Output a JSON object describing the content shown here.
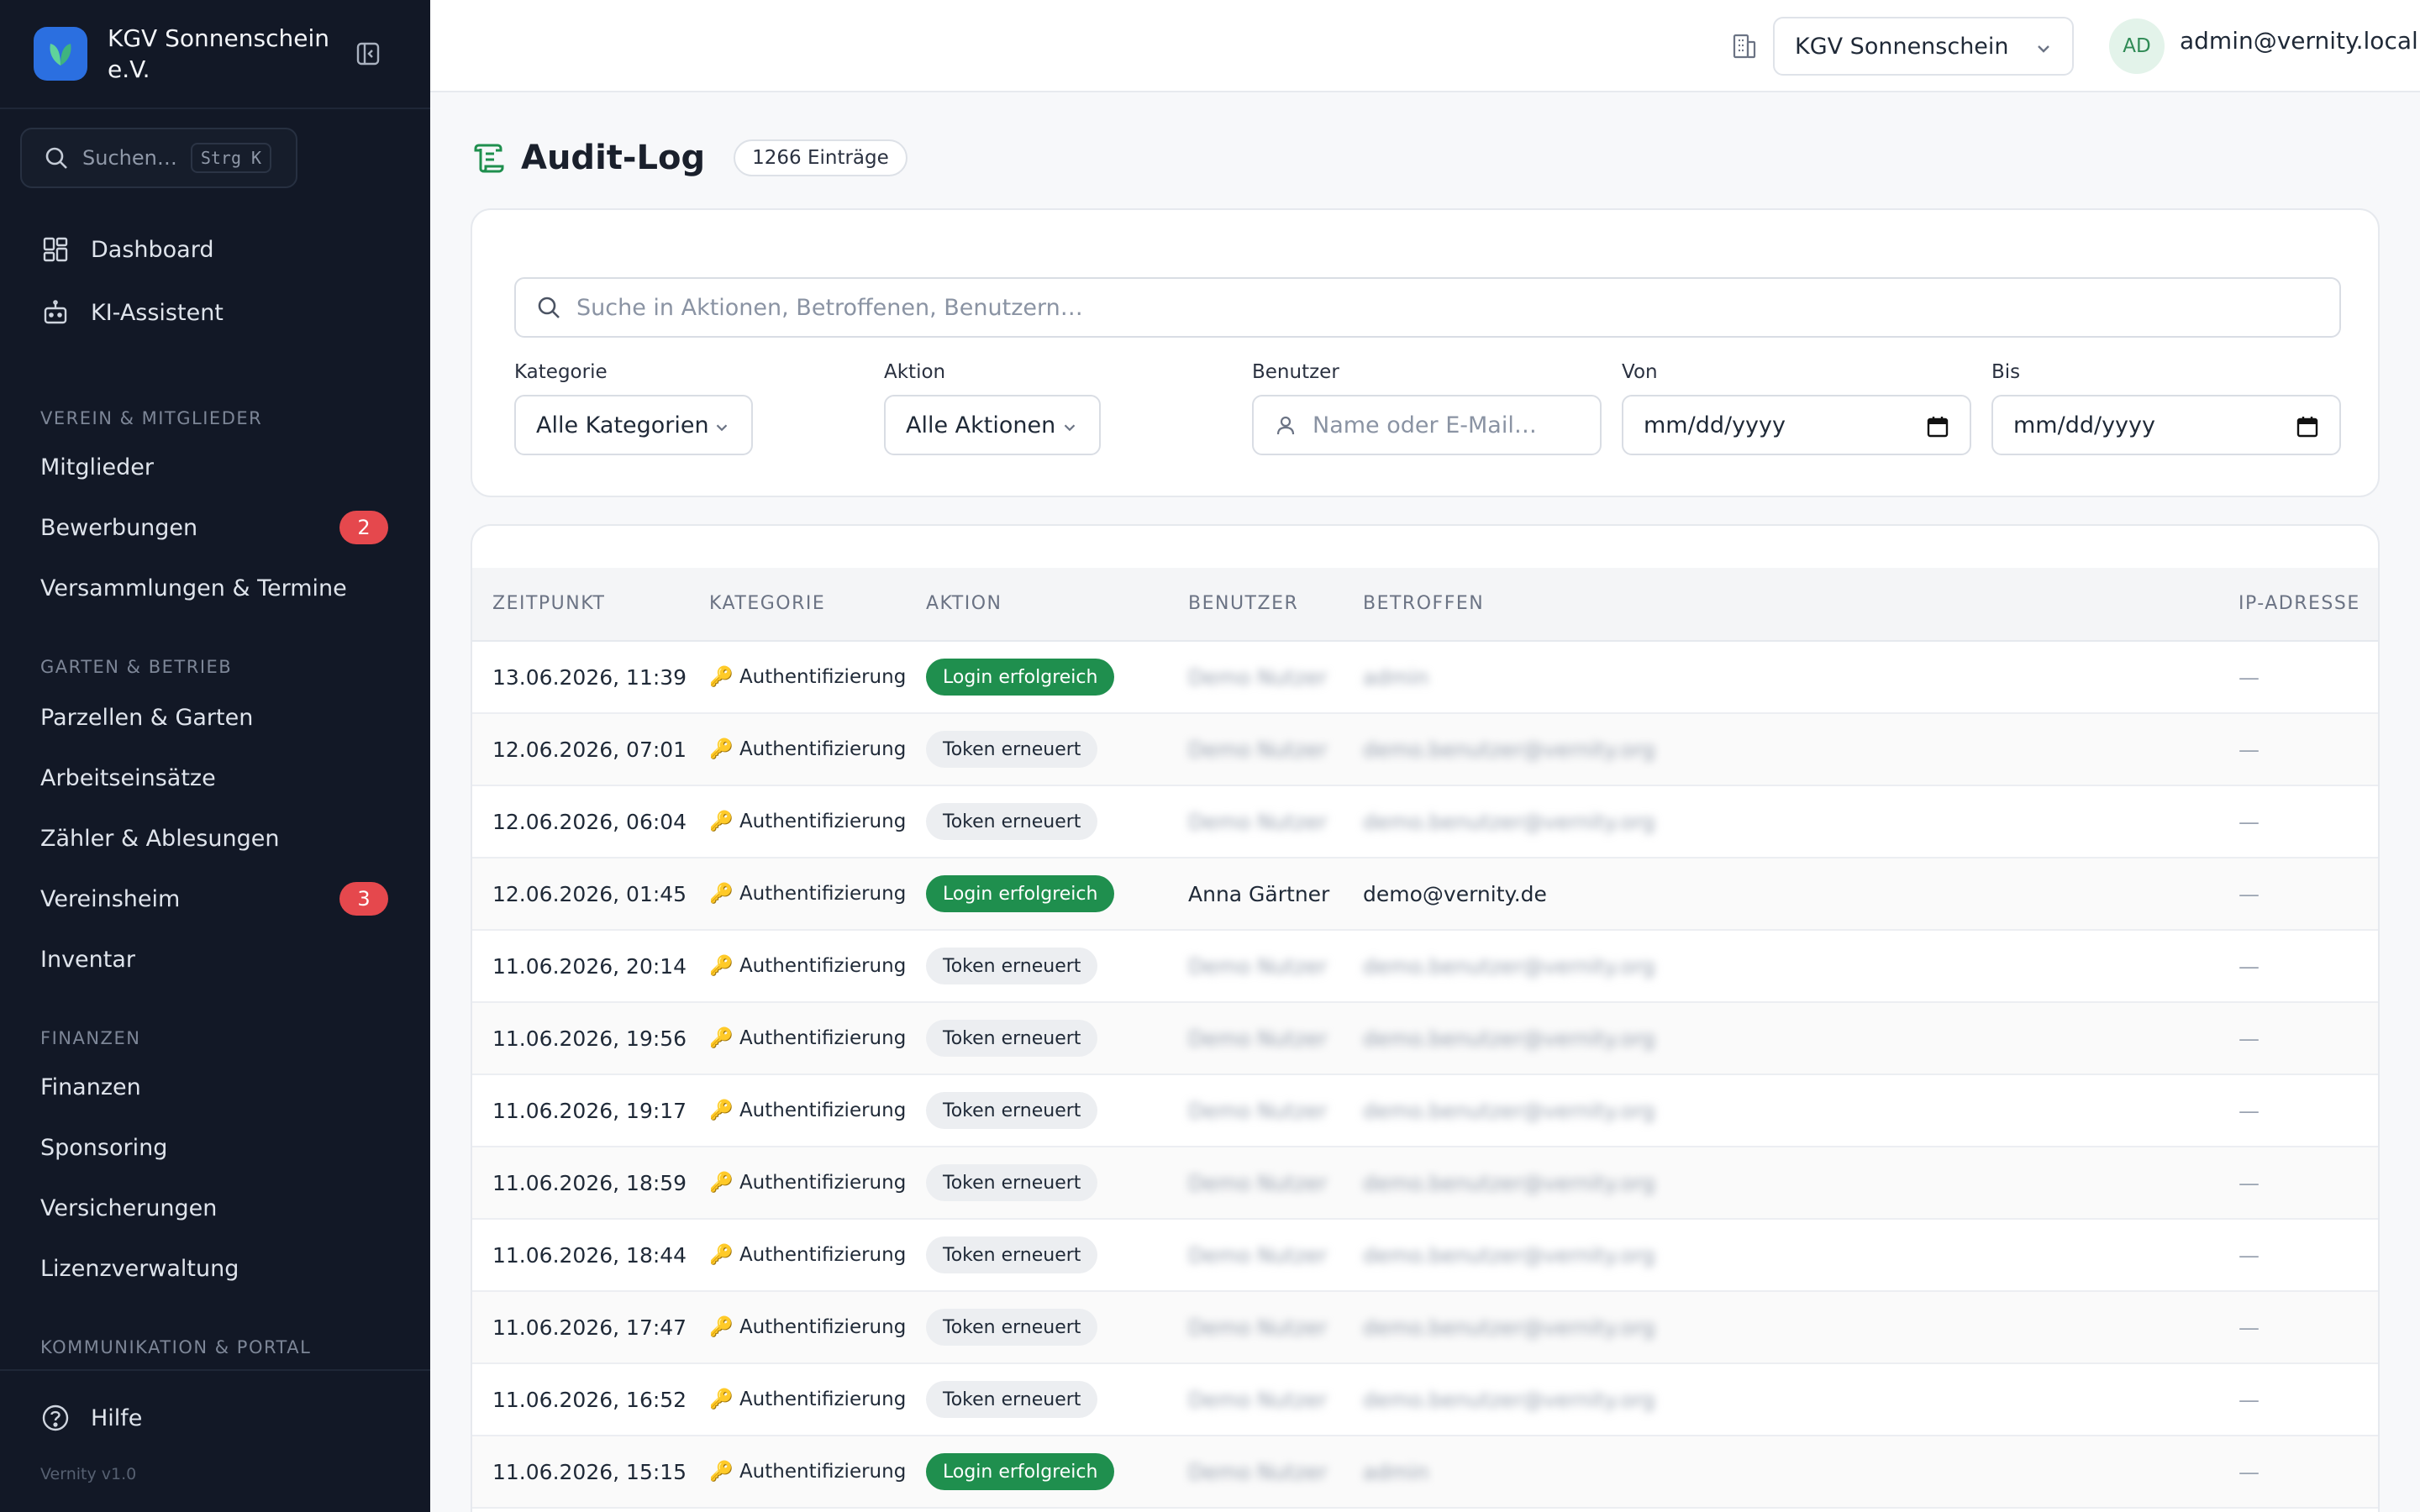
{
  "sidebar": {
    "org_name": "KGV Sonnenschein e.V.",
    "search_placeholder": "Suchen…",
    "search_shortcut": "Strg K",
    "top_items": [
      {
        "label": "Dashboard",
        "icon": "dashboard-icon"
      },
      {
        "label": "KI-Assistent",
        "icon": "robot-icon"
      }
    ],
    "sections": [
      {
        "title": "VEREIN & MITGLIEDER",
        "items": [
          {
            "label": "Mitglieder"
          },
          {
            "label": "Bewerbungen",
            "badge": "2"
          },
          {
            "label": "Versammlungen & Termine"
          }
        ]
      },
      {
        "title": "GARTEN & BETRIEB",
        "items": [
          {
            "label": "Parzellen & Garten"
          },
          {
            "label": "Arbeitseinsätze"
          },
          {
            "label": "Zähler & Ablesungen"
          },
          {
            "label": "Vereinsheim",
            "badge": "3"
          },
          {
            "label": "Inventar"
          }
        ]
      },
      {
        "title": "FINANZEN",
        "items": [
          {
            "label": "Finanzen"
          },
          {
            "label": "Sponsoring"
          },
          {
            "label": "Versicherungen"
          },
          {
            "label": "Lizenzverwaltung"
          }
        ]
      },
      {
        "title": "KOMMUNIKATION & PORTAL",
        "items": []
      }
    ],
    "help_label": "Hilfe",
    "version": "Vernity v1.0"
  },
  "topbar": {
    "org_select_value": "KGV Sonnenschein e.V.",
    "avatar_initials": "AD",
    "user_email": "admin@vernity.local"
  },
  "page": {
    "title": "Audit-Log",
    "entry_count": "1266 Einträge"
  },
  "filters": {
    "search_placeholder": "Suche in Aktionen, Betroffenen, Benutzern…",
    "category_label": "Kategorie",
    "category_value": "Alle Kategorien",
    "action_label": "Aktion",
    "action_value": "Alle Aktionen",
    "user_label": "Benutzer",
    "user_placeholder": "Name oder E-Mail…",
    "from_label": "Von",
    "from_placeholder": "mm/dd/yyyy",
    "to_label": "Bis",
    "to_placeholder": "mm/dd/yyyy"
  },
  "table": {
    "columns": [
      "ZEITPUNKT",
      "KATEGORIE",
      "AKTION",
      "BENUTZER",
      "BETROFFEN",
      "IP-ADRESSE"
    ],
    "rows": [
      {
        "time": "13.06.2026, 11:39",
        "category": "🔑 Authentifizierung",
        "action": "Login erfolgreich",
        "action_type": "success",
        "user": "Demo Nutzer",
        "affected": "admin",
        "ip": "—",
        "redacted": true
      },
      {
        "time": "12.06.2026, 07:01",
        "category": "🔑 Authentifizierung",
        "action": "Token erneuert",
        "action_type": "neutral",
        "user": "Demo Nutzer",
        "affected": "demo.benutzer@vernity.org",
        "ip": "—",
        "redacted": true
      },
      {
        "time": "12.06.2026, 06:04",
        "category": "🔑 Authentifizierung",
        "action": "Token erneuert",
        "action_type": "neutral",
        "user": "Demo Nutzer",
        "affected": "demo.benutzer@vernity.org",
        "ip": "—",
        "redacted": true
      },
      {
        "time": "12.06.2026, 01:45",
        "category": "🔑 Authentifizierung",
        "action": "Login erfolgreich",
        "action_type": "success",
        "user": "Anna Gärtner",
        "affected": "demo@vernity.de",
        "ip": "—",
        "redacted": false
      },
      {
        "time": "11.06.2026, 20:14",
        "category": "🔑 Authentifizierung",
        "action": "Token erneuert",
        "action_type": "neutral",
        "user": "Demo Nutzer",
        "affected": "demo.benutzer@vernity.org",
        "ip": "—",
        "redacted": true
      },
      {
        "time": "11.06.2026, 19:56",
        "category": "🔑 Authentifizierung",
        "action": "Token erneuert",
        "action_type": "neutral",
        "user": "Demo Nutzer",
        "affected": "demo.benutzer@vernity.org",
        "ip": "—",
        "redacted": true
      },
      {
        "time": "11.06.2026, 19:17",
        "category": "🔑 Authentifizierung",
        "action": "Token erneuert",
        "action_type": "neutral",
        "user": "Demo Nutzer",
        "affected": "demo.benutzer@vernity.org",
        "ip": "—",
        "redacted": true
      },
      {
        "time": "11.06.2026, 18:59",
        "category": "🔑 Authentifizierung",
        "action": "Token erneuert",
        "action_type": "neutral",
        "user": "Demo Nutzer",
        "affected": "demo.benutzer@vernity.org",
        "ip": "—",
        "redacted": true
      },
      {
        "time": "11.06.2026, 18:44",
        "category": "🔑 Authentifizierung",
        "action": "Token erneuert",
        "action_type": "neutral",
        "user": "Demo Nutzer",
        "affected": "demo.benutzer@vernity.org",
        "ip": "—",
        "redacted": true
      },
      {
        "time": "11.06.2026, 17:47",
        "category": "🔑 Authentifizierung",
        "action": "Token erneuert",
        "action_type": "neutral",
        "user": "Demo Nutzer",
        "affected": "demo.benutzer@vernity.org",
        "ip": "—",
        "redacted": true
      },
      {
        "time": "11.06.2026, 16:52",
        "category": "🔑 Authentifizierung",
        "action": "Token erneuert",
        "action_type": "neutral",
        "user": "Demo Nutzer",
        "affected": "demo.benutzer@vernity.org",
        "ip": "—",
        "redacted": true
      },
      {
        "time": "11.06.2026, 15:15",
        "category": "🔑 Authentifizierung",
        "action": "Login erfolgreich",
        "action_type": "success",
        "user": "Demo Nutzer",
        "affected": "admin",
        "ip": "—",
        "redacted": true
      }
    ]
  },
  "colors": {
    "sidebar_bg": "#121826",
    "success": "#1f8f4e",
    "badge": "#e5484d",
    "logo": "#2b6fe0"
  }
}
